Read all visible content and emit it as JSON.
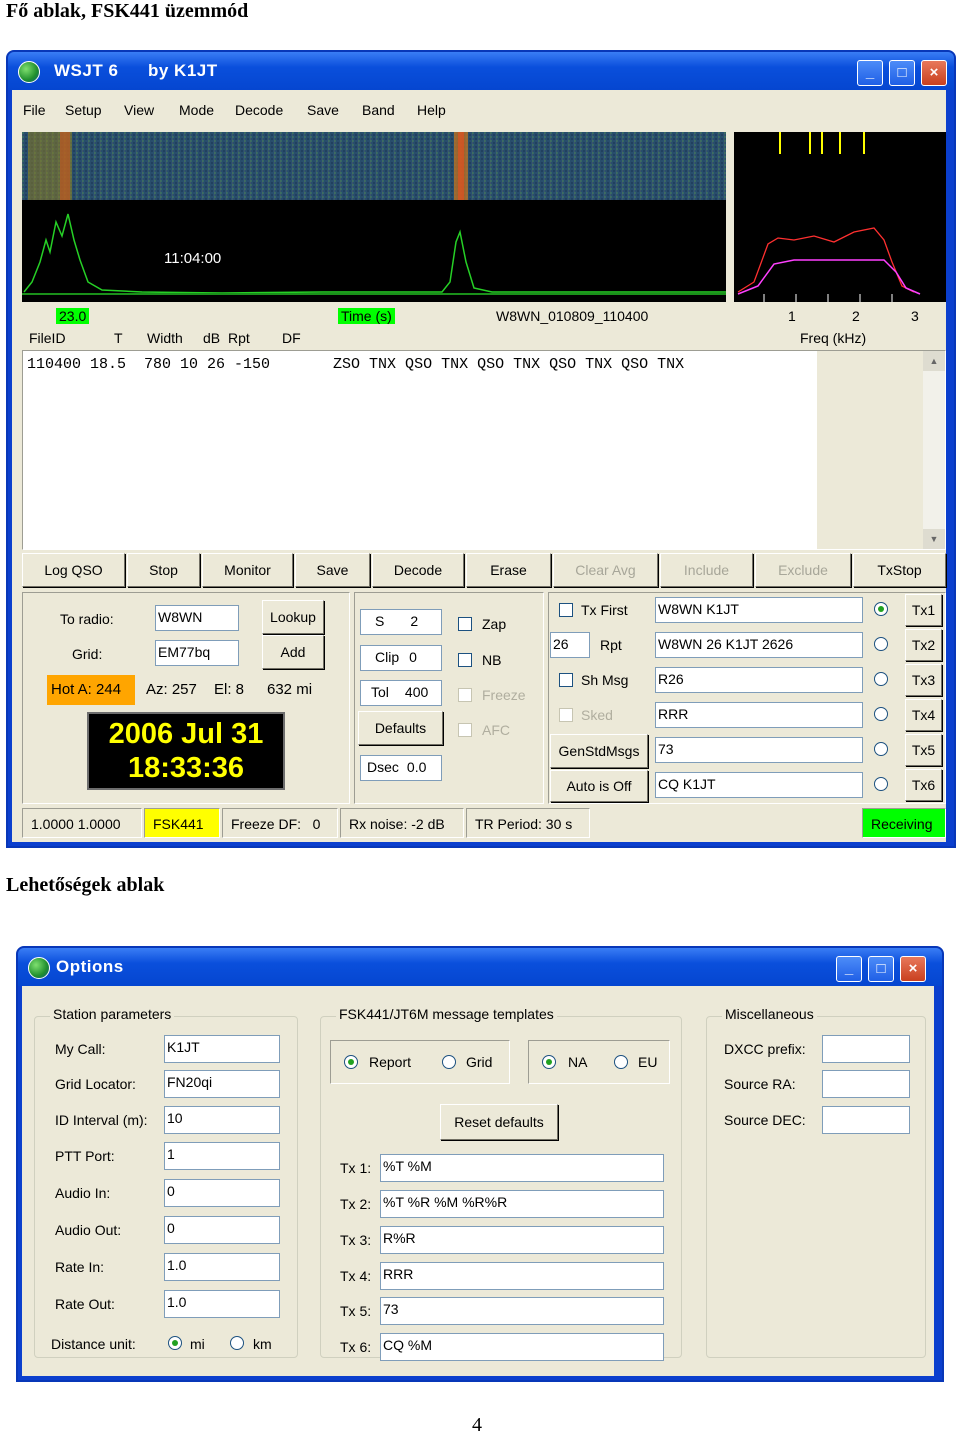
{
  "doc": {
    "heading1": "Fő ablak, FSK441 üzemmód",
    "heading2": "Lehetőségek ablak",
    "page_number": "4"
  },
  "main_window": {
    "title": "WSJT 6",
    "title_by": "by K1JT",
    "menu": [
      "File",
      "Setup",
      "View",
      "Mode",
      "Decode",
      "Save",
      "Band",
      "Help"
    ],
    "waterfall": {
      "time_label": "11:04:00",
      "value_left": "23.0",
      "time_axis": "Time (s)",
      "file_name": "W8WN_010809_110400",
      "freq_ticks": [
        "1",
        "2",
        "3"
      ],
      "freq_axis": "Freq (kHz)"
    },
    "decode_headers": [
      "FileID",
      "T",
      "Width",
      "dB",
      "Rpt",
      "DF"
    ],
    "decode_line": "110400 18.5  780 10 26 -150       ZSO TNX QSO TNX QSO TNX QSO TNX QSO TNX",
    "buttons": [
      {
        "label": "Log QSO",
        "enabled": true
      },
      {
        "label": "Stop",
        "enabled": true
      },
      {
        "label": "Monitor",
        "enabled": true
      },
      {
        "label": "Save",
        "enabled": true
      },
      {
        "label": "Decode",
        "enabled": true
      },
      {
        "label": "Erase",
        "enabled": true
      },
      {
        "label": "Clear Avg",
        "enabled": false
      },
      {
        "label": "Include",
        "enabled": false
      },
      {
        "label": "Exclude",
        "enabled": false
      },
      {
        "label": "TxStop",
        "enabled": true
      }
    ],
    "station": {
      "to_radio_label": "To radio:",
      "to_radio_value": "W8WN",
      "lookup_label": "Lookup",
      "grid_label": "Grid:",
      "grid_value": "EM77bq",
      "add_label": "Add",
      "hot_a": "Hot A: 244",
      "az": "Az: 257",
      "el": "El: 8",
      "distance": "632 mi",
      "date": "2006 Jul 31",
      "time": "18:33:36"
    },
    "controls": {
      "s_label": "S",
      "s_value": "2",
      "clip_label": "Clip",
      "clip_value": "0",
      "tol_label": "Tol",
      "tol_value": "400",
      "defaults_label": "Defaults",
      "dsec_label": "Dsec",
      "dsec_value": "0.0",
      "zap": "Zap",
      "nb": "NB",
      "freeze": "Freeze",
      "afc": "AFC"
    },
    "tx": {
      "tx_first": "Tx First",
      "rpt_value": "26",
      "rpt_label": "Rpt",
      "sh_msg": "Sh Msg",
      "sked": "Sked",
      "gen_std_msgs": "GenStdMsgs",
      "auto_is_off": "Auto is Off",
      "messages": [
        "W8WN K1JT",
        "W8WN 26 K1JT 2626",
        "R26",
        "RRR",
        "73",
        "CQ K1JT"
      ],
      "selected_index": 0,
      "tx_buttons": [
        "Tx1",
        "Tx2",
        "Tx3",
        "Tx4",
        "Tx5",
        "Tx6"
      ]
    },
    "status_bar": {
      "ratio": "1.0000 1.0000",
      "mode": "FSK441",
      "freeze_df": "Freeze DF:   0",
      "rx_noise": "Rx noise: -2 dB",
      "tr_period": "TR Period: 30 s",
      "state": "Receiving"
    },
    "colors": {
      "mode_bg": "#ffff00",
      "state_bg": "#00ff00",
      "hot_bg": "#ffa500",
      "clock_bg": "#000000",
      "clock_fg": "#ffff00"
    }
  },
  "options_window": {
    "title": "Options",
    "station_group": "Station parameters",
    "fields": [
      {
        "label": "My Call:",
        "value": "K1JT"
      },
      {
        "label": "Grid Locator:",
        "value": "FN20qi"
      },
      {
        "label": "ID Interval (m):",
        "value": "10"
      },
      {
        "label": "PTT Port:",
        "value": "1"
      },
      {
        "label": "Audio In:",
        "value": "0"
      },
      {
        "label": "Audio Out:",
        "value": "0"
      },
      {
        "label": "Rate In:",
        "value": "1.0"
      },
      {
        "label": "Rate Out:",
        "value": "1.0"
      }
    ],
    "distance_unit_label": "Distance unit:",
    "distance_units": [
      {
        "label": "mi",
        "selected": true
      },
      {
        "label": "km",
        "selected": false
      }
    ],
    "templates_group": "FSK441/JT6M message templates",
    "mode_radios": [
      {
        "label": "Report",
        "selected": true
      },
      {
        "label": "Grid",
        "selected": false
      }
    ],
    "region_radios": [
      {
        "label": "NA",
        "selected": true
      },
      {
        "label": "EU",
        "selected": false
      }
    ],
    "reset_defaults": "Reset defaults",
    "templates": [
      {
        "label": "Tx 1:",
        "value": "%T %M"
      },
      {
        "label": "Tx 2:",
        "value": "%T %R %M %R%R"
      },
      {
        "label": "Tx 3:",
        "value": "R%R"
      },
      {
        "label": "Tx 4:",
        "value": "RRR"
      },
      {
        "label": "Tx 5:",
        "value": "73"
      },
      {
        "label": "Tx 6:",
        "value": "CQ %M"
      }
    ],
    "misc_group": "Miscellaneous",
    "misc_fields": [
      {
        "label": "DXCC prefix:",
        "value": ""
      },
      {
        "label": "Source RA:",
        "value": ""
      },
      {
        "label": "Source DEC:",
        "value": ""
      }
    ]
  }
}
